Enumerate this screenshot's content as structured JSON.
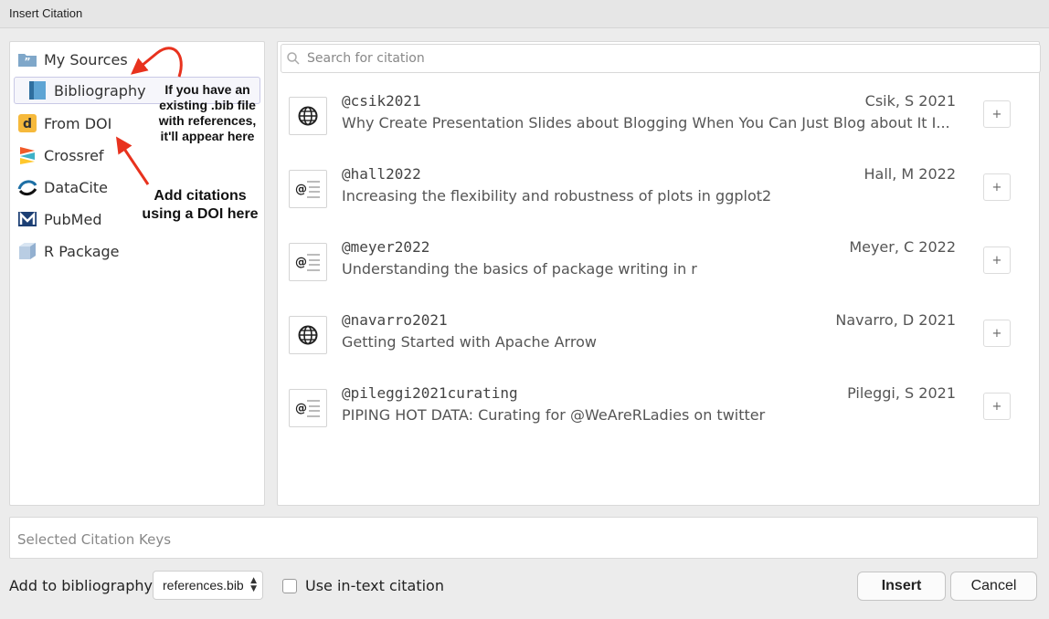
{
  "window": {
    "title": "Insert Citation"
  },
  "sidebar": {
    "items": [
      {
        "label": "My Sources",
        "icon": "my-sources-icon"
      },
      {
        "label": "Bibliography",
        "icon": "book-icon",
        "selected": true
      },
      {
        "label": "From DOI",
        "icon": "doi-icon"
      },
      {
        "label": "Crossref",
        "icon": "crossref-icon"
      },
      {
        "label": "DataCite",
        "icon": "datacite-icon"
      },
      {
        "label": "PubMed",
        "icon": "pubmed-icon"
      },
      {
        "label": "R Package",
        "icon": "r-package-icon"
      }
    ]
  },
  "annotations": {
    "bib_note": [
      "If you have an",
      "existing .bib file",
      "with references,",
      "it'll appear here"
    ],
    "doi_note": [
      "Add citations",
      "using a DOI here"
    ],
    "arrow_color": "#e8321e"
  },
  "search": {
    "placeholder": "Search for citation",
    "value": ""
  },
  "citations": [
    {
      "key": "@csik2021",
      "author": "Csik, S 2021",
      "title": "Why Create Presentation Slides about Blogging When You Can Just Blog about It I...",
      "icon": "globe-icon",
      "add": "+"
    },
    {
      "key": "@hall2022",
      "author": "Hall, M 2022",
      "title": "Increasing the flexibility and robustness of plots in ggplot2",
      "icon": "article-icon",
      "add": "+"
    },
    {
      "key": "@meyer2022",
      "author": "Meyer, C 2022",
      "title": "Understanding the basics of package writing in r",
      "icon": "article-icon",
      "add": "+"
    },
    {
      "key": "@navarro2021",
      "author": "Navarro, D 2021",
      "title": "Getting Started with Apache Arrow",
      "icon": "globe-icon",
      "add": "+"
    },
    {
      "key": "@pileggi2021curating",
      "author": "Pileggi, S 2021",
      "title": "PIPING HOT DATA: Curating for @WeAreRLadies on twitter",
      "icon": "article-icon",
      "add": "+"
    }
  ],
  "selected_keys": {
    "placeholder": "Selected Citation Keys"
  },
  "footer": {
    "add_to_label": "Add to bibliography:",
    "bibliography_value": "references.bib",
    "in_text_label": "Use in-text citation",
    "in_text_checked": false,
    "insert_label": "Insert",
    "cancel_label": "Cancel"
  }
}
